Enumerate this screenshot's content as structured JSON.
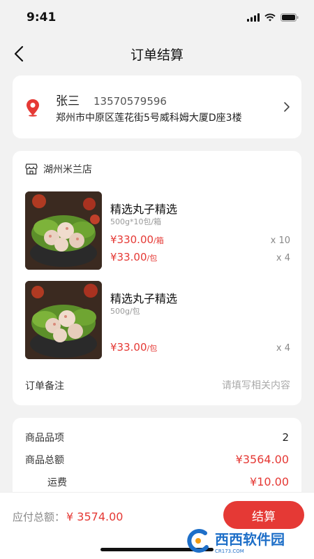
{
  "status_bar": {
    "time": "9:41"
  },
  "nav": {
    "title": "订单结算"
  },
  "address": {
    "name": "张三",
    "phone": "13570579596",
    "detail": "郑州市中原区莲花街5号威科姆大厦D座3楼"
  },
  "shop": {
    "name": "湖州米兰店"
  },
  "products": [
    {
      "title": "精选丸子精选",
      "spec": "500g*10包/箱",
      "prices": [
        {
          "price": "¥330.00",
          "unit": "/箱",
          "qty": "x 10"
        },
        {
          "price": "¥33.00",
          "unit": "/包",
          "qty": "x 4"
        }
      ]
    },
    {
      "title": "精选丸子精选",
      "spec": "500g/包",
      "prices": [
        {
          "price": "¥33.00",
          "unit": "/包",
          "qty": "x 4"
        }
      ]
    }
  ],
  "remark": {
    "label": "订单备注",
    "placeholder": "请填写相关内容"
  },
  "summary": {
    "items_label": "商品品项",
    "items_value": "2",
    "total_label": "商品总额",
    "total_value": "¥3564.00",
    "shipping_label": "运费",
    "shipping_value": "¥10.00"
  },
  "bottom": {
    "total_label": "应付总额：",
    "total_amount": "¥ 3574.00",
    "pay_label": "结算"
  },
  "watermark": {
    "text": "西西软件园",
    "sub": "CR173.COM"
  },
  "colors": {
    "accent": "#e53935",
    "background": "#f2f2f2"
  }
}
